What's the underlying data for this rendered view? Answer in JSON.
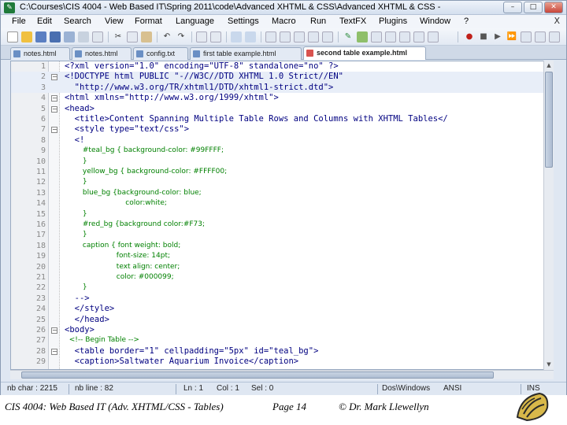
{
  "window": {
    "title": "C:\\Courses\\CIS 4004 - Web Based IT\\Spring 2011\\code\\Advanced XHTML & CSS\\Advanced XHTML & CSS -",
    "controls": {
      "minimize": "–",
      "maximize": "□",
      "close": "✕"
    }
  },
  "menu": {
    "items": [
      "File",
      "Edit",
      "Search",
      "View",
      "Format",
      "Language",
      "Settings",
      "Macro",
      "Run",
      "TextFX",
      "Plugins",
      "Window",
      "?"
    ],
    "close_glyph": "X"
  },
  "tabs": [
    {
      "label": "notes.html",
      "active": false
    },
    {
      "label": "notes.html",
      "active": false
    },
    {
      "label": "config.txt",
      "active": false
    },
    {
      "label": "first table example.html",
      "active": false
    },
    {
      "label": "second table example.html",
      "active": true
    }
  ],
  "editor": {
    "lines": [
      {
        "n": "1",
        "text": "<?xml version=\"1.0\" encoding=\"UTF-8\" standalone=\"no\" ?>",
        "fold": "",
        "css": false,
        "hl": false
      },
      {
        "n": "2",
        "text": "<!DOCTYPE html PUBLIC \"-//W3C//DTD XHTML 1.0 Strict//EN\"",
        "fold": "−",
        "css": false,
        "hl": true
      },
      {
        "n": "3",
        "text": "  \"http://www.w3.org/TR/xhtml1/DTD/xhtml1-strict.dtd\">",
        "fold": "",
        "css": false,
        "hl": true
      },
      {
        "n": "4",
        "text": "<html xmlns=\"http://www.w3.org/1999/xhtml\">",
        "fold": "−",
        "css": false,
        "hl": false
      },
      {
        "n": "5",
        "text": "<head>",
        "fold": "−",
        "css": false,
        "hl": false
      },
      {
        "n": "6",
        "text": "  <title>Content Spanning Multiple Table Rows and Columns with XHTML Tables</",
        "fold": "",
        "css": false,
        "hl": false
      },
      {
        "n": "7",
        "text": "  <style type=\"text/css\">",
        "fold": "−",
        "css": false,
        "hl": false
      },
      {
        "n": "8",
        "text": "  <!",
        "fold": "",
        "css": false,
        "hl": false
      },
      {
        "n": "9",
        "text": "        #teal_bg { background-color: #99FFFF;",
        "fold": "",
        "css": true,
        "hl": false
      },
      {
        "n": "10",
        "text": "        }",
        "fold": "",
        "css": true,
        "hl": false
      },
      {
        "n": "11",
        "text": "        yellow_bg { background-color: #FFFF00;",
        "fold": "",
        "css": true,
        "hl": false
      },
      {
        "n": "12",
        "text": "        }",
        "fold": "",
        "css": true,
        "hl": false
      },
      {
        "n": "13",
        "text": "        blue_bg {background-color: blue;",
        "fold": "",
        "css": true,
        "hl": false
      },
      {
        "n": "14",
        "text": "                           color:white;",
        "fold": "",
        "css": true,
        "hl": false
      },
      {
        "n": "15",
        "text": "        }",
        "fold": "",
        "css": true,
        "hl": false
      },
      {
        "n": "16",
        "text": "        #red_bg {background color:#F73;",
        "fold": "",
        "css": true,
        "hl": false
      },
      {
        "n": "17",
        "text": "        }",
        "fold": "",
        "css": true,
        "hl": false
      },
      {
        "n": "18",
        "text": "        caption { font weight: bold;",
        "fold": "",
        "css": true,
        "hl": false
      },
      {
        "n": "19",
        "text": "                       font-size: 14pt;",
        "fold": "",
        "css": true,
        "hl": false
      },
      {
        "n": "20",
        "text": "                       text align: center;",
        "fold": "",
        "css": true,
        "hl": false
      },
      {
        "n": "21",
        "text": "                       color: #000099;",
        "fold": "",
        "css": true,
        "hl": false
      },
      {
        "n": "22",
        "text": "        }",
        "fold": "",
        "css": true,
        "hl": false
      },
      {
        "n": "23",
        "text": "  -->",
        "fold": "",
        "css": false,
        "hl": false
      },
      {
        "n": "24",
        "text": "  </style>",
        "fold": "",
        "css": false,
        "hl": false
      },
      {
        "n": "25",
        "text": "  </head>",
        "fold": "",
        "css": false,
        "hl": false
      },
      {
        "n": "26",
        "text": "<body>",
        "fold": "−",
        "css": false,
        "hl": false
      },
      {
        "n": "27",
        "text": "  <!-- Begin Table -->",
        "fold": "",
        "css": true,
        "hl": false
      },
      {
        "n": "28",
        "text": "  <table border=\"1\" cellpadding=\"5px\" id=\"teal_bg\">",
        "fold": "−",
        "css": false,
        "hl": false
      },
      {
        "n": "29",
        "text": "  <caption>Saltwater Aquarium Invoice</caption>",
        "fold": "",
        "css": false,
        "hl": false
      }
    ]
  },
  "status": {
    "nb_char": "nb char : 2215",
    "nb_line": "nb line : 82",
    "ln": "Ln : 1",
    "col": "Col : 1",
    "sel": "Sel : 0",
    "eol": "Dos\\Windows",
    "encoding": "ANSI",
    "mode": "INS"
  },
  "footer": {
    "course": "CIS 4004: Web Based IT (Adv. XHTML/CSS - Tables)",
    "page": "Page 14",
    "author": "© Dr. Mark Llewellyn"
  },
  "colors": {
    "accent": "#6a8fc4",
    "code_tag": "#000080",
    "code_css": "#008000",
    "active_tab_icon": "#d9534f"
  }
}
